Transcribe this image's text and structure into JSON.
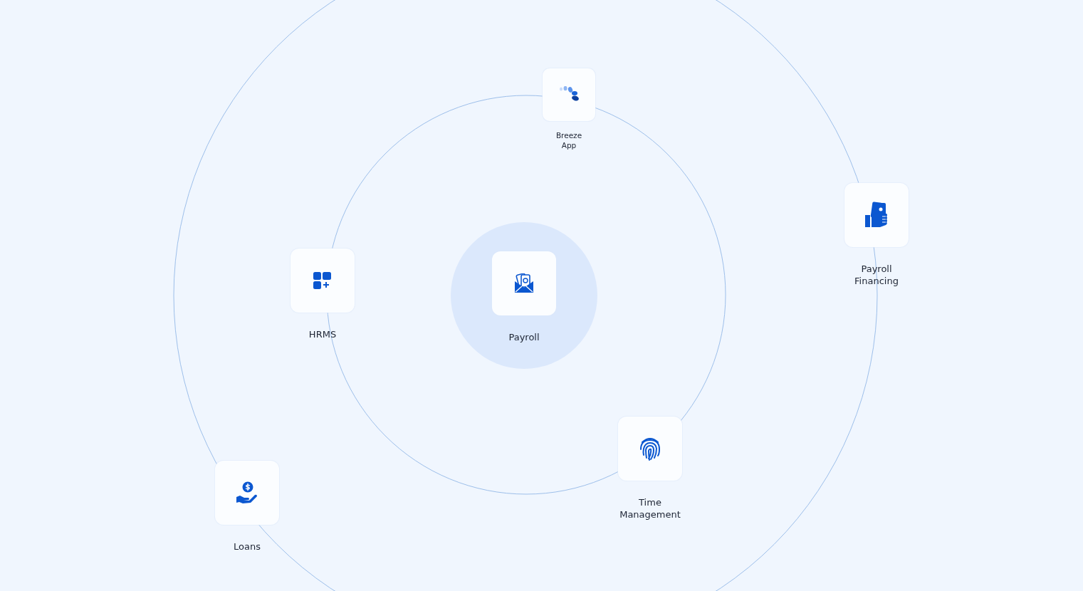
{
  "center": {
    "label": "Payroll"
  },
  "nodes": [
    {
      "label": "Breeze App",
      "kind": "small"
    },
    {
      "label": "Payroll Financing",
      "kind": "large"
    },
    {
      "label": "HRMS",
      "kind": "large"
    },
    {
      "label": "Time Management",
      "kind": "large"
    },
    {
      "label": "Loans",
      "kind": "large"
    }
  ]
}
